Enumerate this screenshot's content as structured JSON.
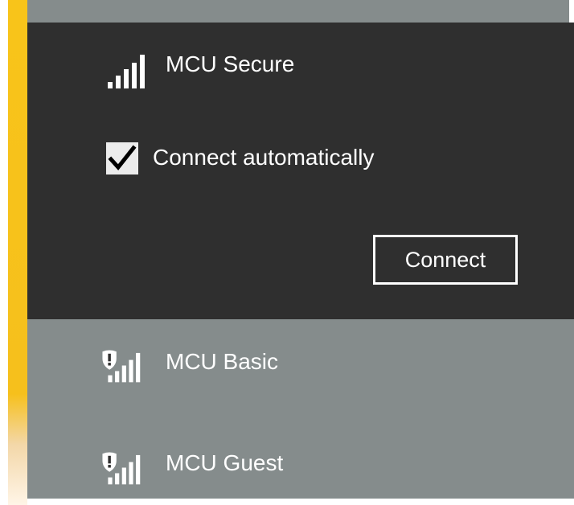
{
  "networks": [
    {
      "name": "MCU Secure",
      "secured": true,
      "expanded": true,
      "connect_automatically_label": "Connect automatically",
      "connect_automatically_checked": true,
      "connect_button_label": "Connect"
    },
    {
      "name": "MCU Basic",
      "secured": false,
      "expanded": false
    },
    {
      "name": "MCU Guest",
      "secured": false,
      "expanded": false
    }
  ],
  "icons": {
    "signal": "wifi-signal-icon",
    "unsecured_warning": "shield-warning-icon",
    "checkmark": "checkmark-icon"
  },
  "colors": {
    "expanded_bg": "#2f2f2f",
    "list_bg": "#858c8c",
    "text": "#ffffff",
    "checkbox_bg": "#ececec",
    "wallpaper_accent": "#f8c41a"
  }
}
